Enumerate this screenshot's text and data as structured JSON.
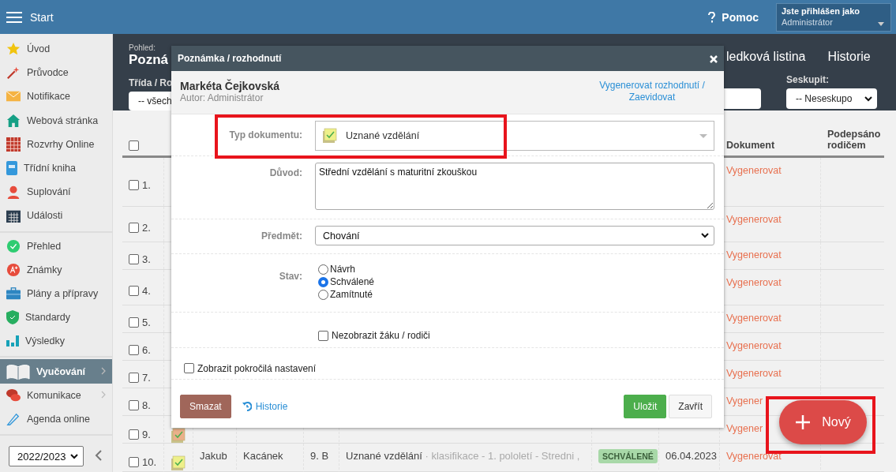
{
  "topbar": {
    "title": "Start",
    "help": "Pomoc",
    "user_label": "Jste přihlášen jako",
    "user": "Administrátor"
  },
  "sidebar": {
    "groups": [
      [
        {
          "label": "Úvod",
          "selected": false,
          "arrow": false
        },
        {
          "label": "Průvodce",
          "selected": false,
          "arrow": false
        },
        {
          "label": "Notifikace",
          "selected": false,
          "arrow": false
        },
        {
          "label": "Webová stránka",
          "selected": false,
          "arrow": false
        },
        {
          "label": "Rozvrhy Online",
          "selected": false,
          "arrow": false
        },
        {
          "label": "Třídní kniha",
          "selected": false,
          "arrow": false
        },
        {
          "label": "Suplování",
          "selected": false,
          "arrow": false
        },
        {
          "label": "Události",
          "selected": false,
          "arrow": false
        }
      ],
      [
        {
          "label": "Přehled",
          "selected": false,
          "arrow": false
        },
        {
          "label": "Známky",
          "selected": false,
          "arrow": false
        },
        {
          "label": "Plány a přípravy",
          "selected": false,
          "arrow": false
        },
        {
          "label": "Standardy",
          "selected": false,
          "arrow": false
        },
        {
          "label": "Výsledky",
          "selected": false,
          "arrow": false
        }
      ],
      [
        {
          "label": "Vyučování",
          "selected": true,
          "arrow": true
        },
        {
          "label": "Komunikace",
          "selected": false,
          "arrow": true
        },
        {
          "label": "Agenda online",
          "selected": false,
          "arrow": false
        }
      ]
    ],
    "year": "2022/2023"
  },
  "view": {
    "label": "Pohled:",
    "title": "Pozná",
    "filter_label": "Třída / Ro",
    "filter_value": "-- všech",
    "tabs": [
      "ledková listina",
      "Historie"
    ],
    "group_label": "Seskupit:",
    "group_value": "-- Neseskupo"
  },
  "table": {
    "all_checked": false,
    "columns": [
      "Dokument",
      "Podepsáno rodičem"
    ],
    "rows": [
      {
        "number": "1.",
        "checked": false,
        "document": "Vygenerovat"
      },
      {
        "number": "2.",
        "checked": false,
        "document": "Vygenerovat"
      },
      {
        "number": "3.",
        "checked": false,
        "document": "Vygenerovat"
      },
      {
        "number": "4.",
        "checked": false,
        "document": "Vygenerovat"
      },
      {
        "number": "5.",
        "checked": false,
        "document": "Vygenerovat"
      },
      {
        "number": "6.",
        "checked": false,
        "document": "Vygenerovat"
      },
      {
        "number": "7.",
        "checked": false,
        "document": "Vygenerovat"
      },
      {
        "number": "8.",
        "checked": false,
        "document": "Vygener"
      },
      {
        "number": "9.",
        "checked": false,
        "color": "#eab08a",
        "document": "Vygener"
      },
      {
        "number": "10.",
        "checked": false,
        "color": "#eef08a",
        "first_name": "Jakub",
        "last_name": "Kacánek",
        "class": "9. B",
        "title": "Uznané vzdělání",
        "detail": "· klasifikace - 1. pololetí - Stredni ,",
        "status": "SCHVÁLENÉ",
        "date": "06.04.2023",
        "document": "Vygenerovat"
      }
    ]
  },
  "modal": {
    "title": "Poznámka / rozhodnutí",
    "student": "Markéta Čejkovská",
    "author": "Autor: Administrátor",
    "action_link": "Vygenerovat rozhodnutí / Zaevidovat",
    "type_label": "Typ dokumentu:",
    "type_value": "Uznané vzdělání",
    "type_highlighted": true,
    "reason_label": "Důvod:",
    "reason": "Střední vzdělání s maturitní zkouškou",
    "subject_label": "Předmět:",
    "subject": "Chování",
    "state_label": "Stav:",
    "states": [
      {
        "label": "Návrh",
        "selected": false
      },
      {
        "label": "Schválené",
        "selected": true
      },
      {
        "label": "Zamítnuté",
        "selected": false
      }
    ],
    "hide_label": "Nezobrazit žáku / rodiči",
    "hide_checked": false,
    "advanced_label": "Zobrazit pokročilá nastavení",
    "advanced_checked": false,
    "delete": "Smazat",
    "history": "Historie",
    "save": "Uložit",
    "close": "Zavřít"
  },
  "fab": {
    "label": "Nový",
    "highlighted": true
  }
}
